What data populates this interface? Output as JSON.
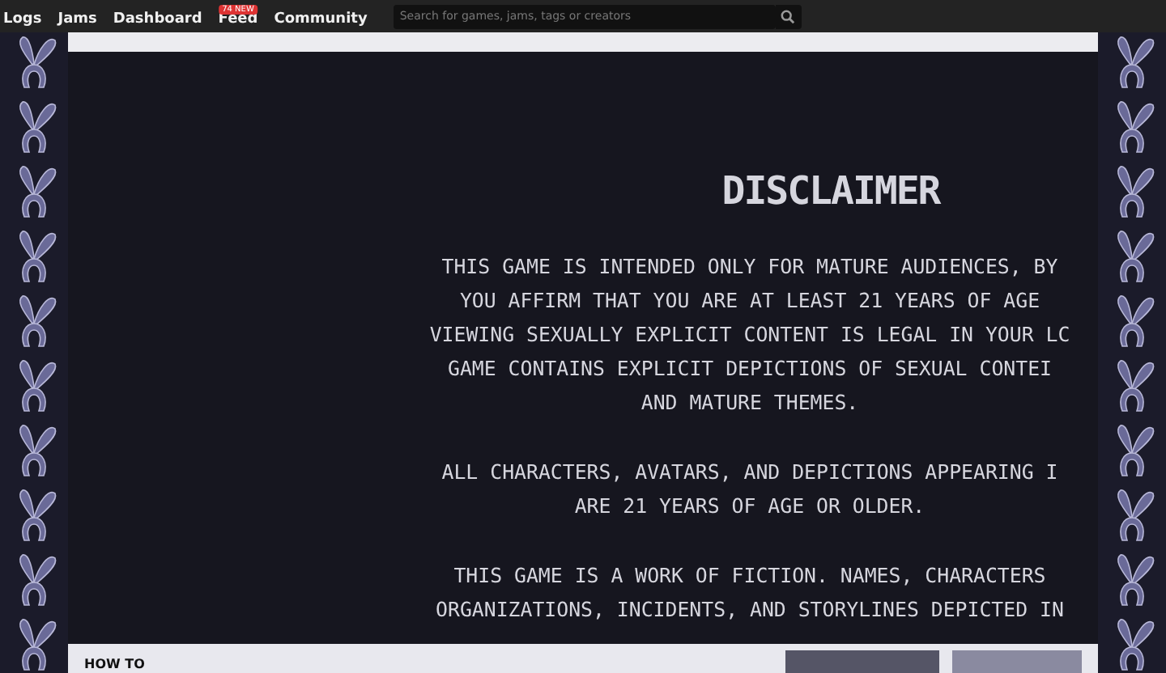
{
  "nav": {
    "links": [
      {
        "label": "Logs"
      },
      {
        "label": "Jams"
      },
      {
        "label": "Dashboard"
      },
      {
        "label": "Feed",
        "badge": "74 NEW"
      },
      {
        "label": "Community"
      }
    ],
    "search": {
      "placeholder": "Search for games, jams, tags or creators"
    }
  },
  "disclaimer": {
    "title": "DISCLAIMER",
    "paragraphs": [
      [
        "THIS GAME IS INTENDED ONLY FOR MATURE AUDIENCES, BY",
        "YOU AFFIRM THAT YOU ARE AT LEAST 21 YEARS OF AGE",
        "VIEWING SEXUALLY EXPLICIT CONTENT IS LEGAL IN YOUR LC",
        "GAME CONTAINS EXPLICIT DEPICTIONS OF SEXUAL CONTEI",
        "AND MATURE THEMES."
      ],
      [
        "ALL CHARACTERS, AVATARS, AND DEPICTIONS APPEARING I",
        "ARE 21 YEARS OF AGE OR OLDER."
      ],
      [
        "THIS GAME IS A WORK OF FICTION. NAMES, CHARACTERS",
        "ORGANIZATIONS, INCIDENTS, AND STORYLINES DEPICTED IN"
      ]
    ]
  },
  "bottom_panel": {
    "heading": "HOW TO"
  }
}
